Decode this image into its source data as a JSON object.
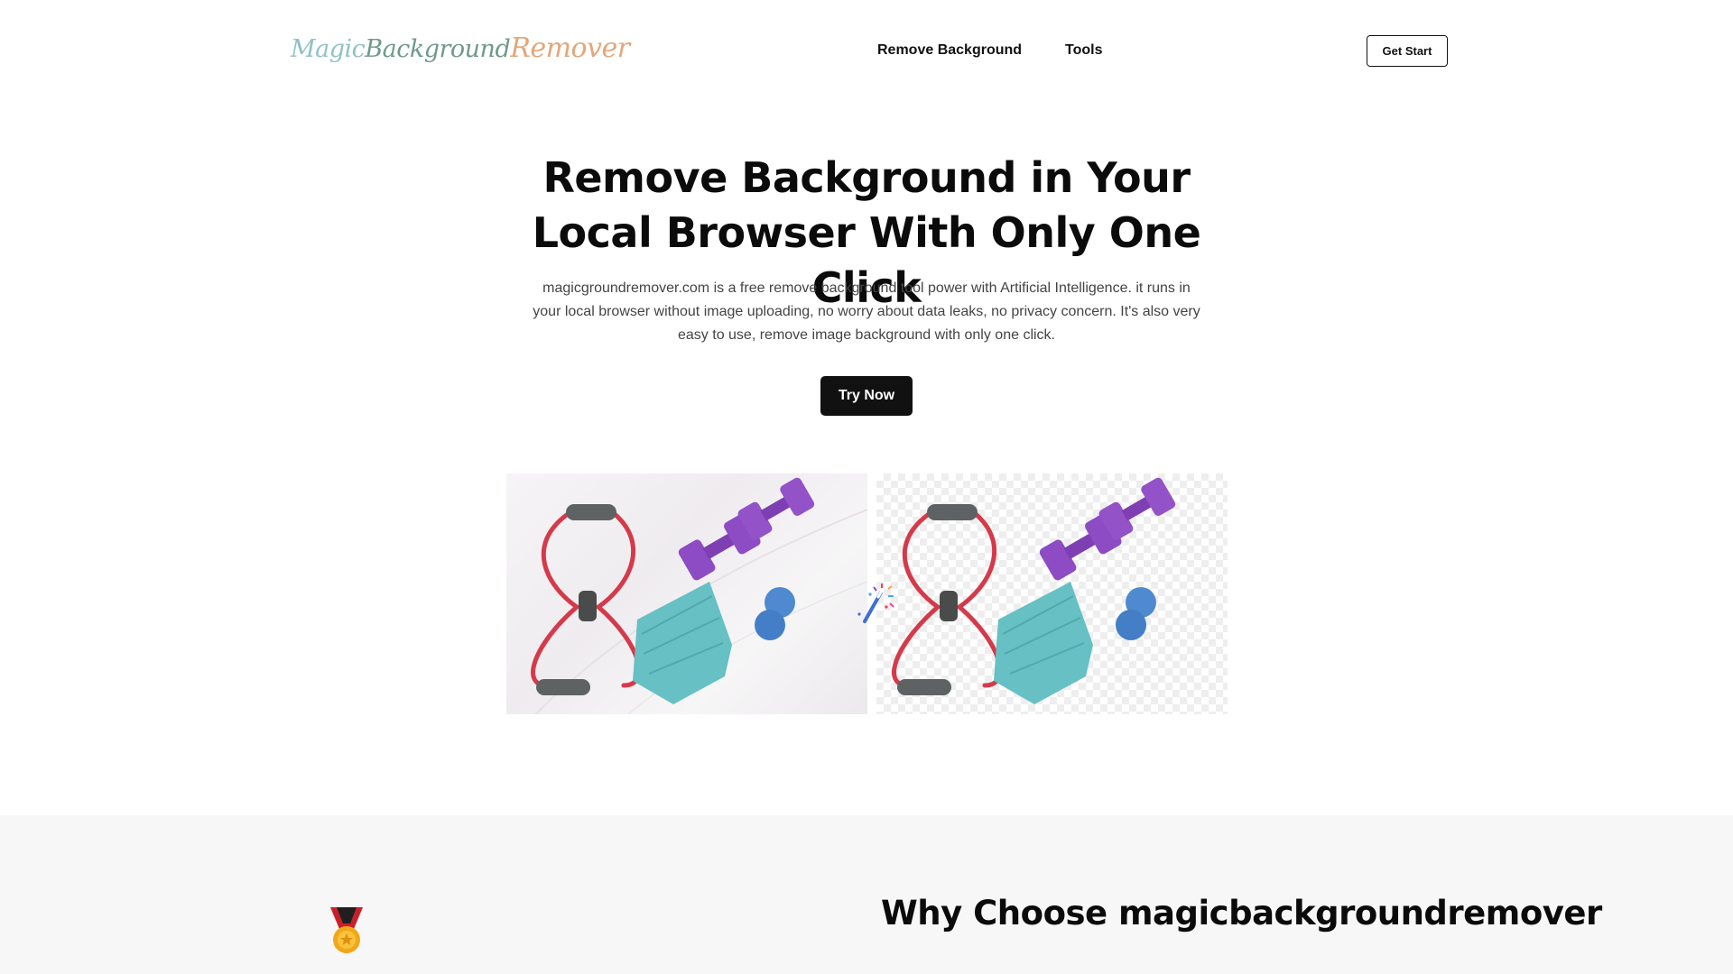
{
  "header": {
    "logo": {
      "part1": "Magic",
      "part2": "Background",
      "part3": "Remover"
    },
    "nav": [
      {
        "label": "Remove Background"
      },
      {
        "label": "Tools"
      }
    ],
    "cta_label": "Get Start"
  },
  "hero": {
    "title": "Remove Background in Your Local Browser With Only One Click",
    "description": "magicgroundremover.com is a free remove background tool power with Artificial Intelligence. it runs in your local browser without image uploading, no worry about data leaks, no privacy concern. It's also very easy to use, remove image background with only one click.",
    "button_label": "Try Now"
  },
  "demo": {
    "before_image": "fitness-equipment-photo",
    "after_image": "fitness-equipment-transparent",
    "icon": "magic-wand-icon"
  },
  "why": {
    "icon": "medal-icon",
    "title": "Why Choose magicbackgroundremover"
  },
  "colors": {
    "logo_teal": "#8fc2c6",
    "logo_green": "#6f9a8a",
    "logo_orange": "#e3a77a",
    "primary_dark": "#111111",
    "section_bg": "#f7f7f7"
  }
}
